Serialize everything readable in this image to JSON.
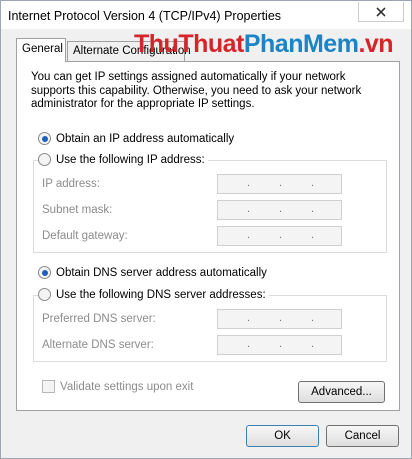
{
  "window": {
    "title": "Internet Protocol Version 4 (TCP/IPv4) Properties"
  },
  "tabs": [
    {
      "label": "General",
      "active": true
    },
    {
      "label": "Alternate Configuration",
      "active": false
    }
  ],
  "watermark": {
    "part1": "ThuThuat",
    "part2": "PhanMem",
    "part3": ".vn"
  },
  "description": "You can get IP settings assigned automatically if your network supports this capability. Otherwise, you need to ask your network administrator for the appropriate IP settings.",
  "ip_section": {
    "auto_label": "Obtain an IP address automatically",
    "auto_selected": true,
    "manual_label": "Use the following IP address:",
    "fields": [
      {
        "label": "IP address:",
        "value": ". . ."
      },
      {
        "label": "Subnet mask:",
        "value": ". . ."
      },
      {
        "label": "Default gateway:",
        "value": ". . ."
      }
    ]
  },
  "dns_section": {
    "auto_label": "Obtain DNS server address automatically",
    "auto_selected": true,
    "manual_label": "Use the following DNS server addresses:",
    "fields": [
      {
        "label": "Preferred DNS server:",
        "value": ". . ."
      },
      {
        "label": "Alternate DNS server:",
        "value": ". . ."
      }
    ]
  },
  "validate_label": "Validate settings upon exit",
  "buttons": {
    "advanced": "Advanced...",
    "ok": "OK",
    "cancel": "Cancel"
  },
  "colors": {
    "watermark_red": "#d4262a",
    "watermark_blue": "#1c83c6",
    "radio_selected": "#1b5fbf"
  }
}
